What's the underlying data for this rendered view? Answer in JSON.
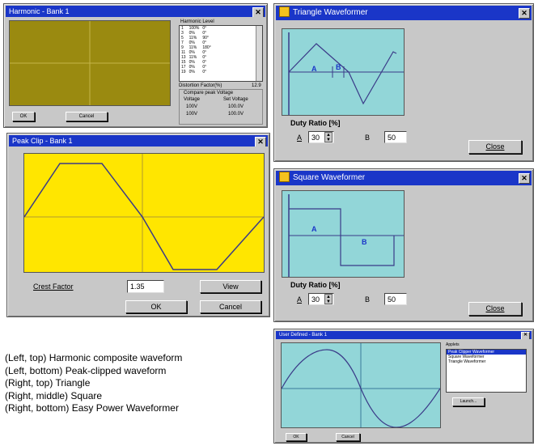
{
  "harmonic": {
    "title": "Harmonic - Bank 1",
    "table_header": "Harmonic Level",
    "rows": [
      [
        "1",
        "100%",
        "0°"
      ],
      [
        "3",
        "0%",
        "0°"
      ],
      [
        "5",
        "11%",
        "90°"
      ],
      [
        "7",
        "0%",
        "0°"
      ],
      [
        "9",
        "11%",
        "180°"
      ],
      [
        "11",
        "0%",
        "0°"
      ],
      [
        "13",
        "11%",
        "0°"
      ],
      [
        "15",
        "0%",
        "0°"
      ],
      [
        "17",
        "0%",
        "0°"
      ],
      [
        "19",
        "0%",
        "0°"
      ]
    ],
    "distortion_label": "Distortion Factor(%)",
    "distortion_value": "12.9",
    "comparison_header": "Compare peak Voltage",
    "col_voltage": "Voltage",
    "col_set_voltage": "Set Voltage",
    "cmp_rows": [
      [
        "100V",
        "100.0V"
      ],
      [
        "100V",
        "100.0V"
      ]
    ],
    "ok_label": "OK",
    "cancel_label": "Cancel"
  },
  "peak_clip": {
    "title": "Peak Clip - Bank 1",
    "crest_factor_label": "Crest Factor",
    "crest_factor_value": "1.35",
    "view_label": "View",
    "ok_label": "OK",
    "cancel_label": "Cancel"
  },
  "triangle": {
    "title": "Triangle Waveformer",
    "label_a": "A",
    "label_b": "B",
    "duty_label": "Duty Ratio [%]",
    "a_label": "A",
    "a_value": "30",
    "b_label": "B",
    "b_value": "50",
    "close_label": "Close"
  },
  "square": {
    "title": "Square Waveformer",
    "label_a": "A",
    "label_b": "B",
    "duty_label": "Duty Ratio [%]",
    "a_label": "A",
    "a_value": "30",
    "b_label": "B",
    "b_value": "50",
    "close_label": "Close"
  },
  "easy": {
    "title": "User Defined - Bank 1",
    "list_header": "Applets",
    "list_items": [
      "Peak Clipper Waveformer",
      "Square Waveformer",
      "Triangle Waveformer"
    ],
    "launch_label": "Launch...",
    "ok_label": "OK",
    "cancel_label": "Cancel"
  },
  "captions": [
    "(Left, top)  Harmonic composite waveform",
    "(Left, bottom)  Peak-clipped waveform",
    "(Right, top)  Triangle",
    "(Right, middle)  Square",
    "(Right, bottom)  Easy Power Waveformer"
  ],
  "colors": {
    "title_bar": "#1a36c8",
    "window_face": "#c8c8c8",
    "olive_plot": "#9a8a10",
    "yellow_plot": "#ffe600",
    "cyan_plot": "#92d6d8",
    "trace": "#3a3a88"
  }
}
